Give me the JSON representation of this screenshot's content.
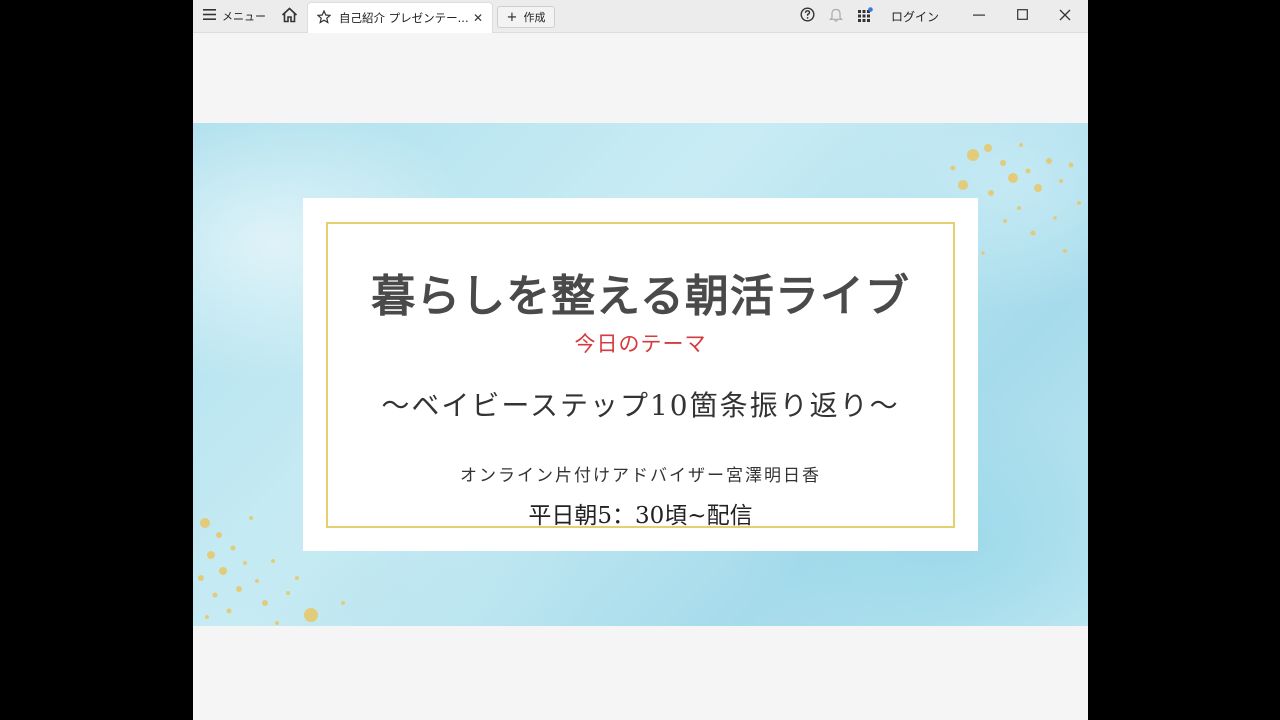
{
  "titlebar": {
    "menu_label": "メニュー",
    "tab_label": "自己紹介 プレゼンテー...",
    "tab_close": "✕",
    "create_label": "作成",
    "create_plus": "+",
    "login_label": "ログイン"
  },
  "slide": {
    "title": "暮らしを整える朝活ライブ",
    "subtitle": "今日のテーマ",
    "theme": "〜ベイビーステップ10箇条振り返り〜",
    "presenter": "オンライン片付けアドバイザー宮澤明日香",
    "schedule": "平日朝5：30頃~配信"
  },
  "colors": {
    "subtitle": "#d63a3f",
    "frame_gold": "#e6cf6e",
    "slide_blue": "#aee0ee",
    "title_gray": "#4a4a4a"
  },
  "icons": {
    "menu": "hamburger-icon",
    "home": "home-icon",
    "tab": "star-icon",
    "help": "help-icon",
    "notifications": "bell-icon",
    "apps": "apps-grid-icon",
    "minimize": "minimize-icon",
    "maximize": "maximize-icon",
    "close": "close-icon"
  }
}
